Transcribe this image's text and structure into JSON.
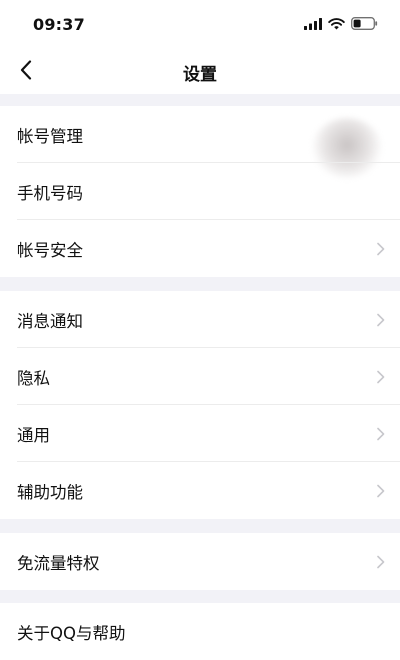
{
  "status": {
    "time": "09:37"
  },
  "nav": {
    "title": "设置"
  },
  "groups": [
    {
      "items": [
        {
          "label": "帐号管理",
          "chevron": false
        },
        {
          "label": "手机号码",
          "chevron": false
        },
        {
          "label": "帐号安全",
          "chevron": true
        }
      ]
    },
    {
      "items": [
        {
          "label": "消息通知",
          "chevron": true
        },
        {
          "label": "隐私",
          "chevron": true
        },
        {
          "label": "通用",
          "chevron": true
        },
        {
          "label": "辅助功能",
          "chevron": true
        }
      ]
    },
    {
      "items": [
        {
          "label": "免流量特权",
          "chevron": true
        }
      ]
    },
    {
      "items": [
        {
          "label": "关于QQ与帮助",
          "chevron": false
        }
      ]
    }
  ],
  "colors": {
    "background": "#f2f2f7",
    "cell": "#ffffff",
    "chevron": "#c7c7cc",
    "text": "#111111"
  }
}
